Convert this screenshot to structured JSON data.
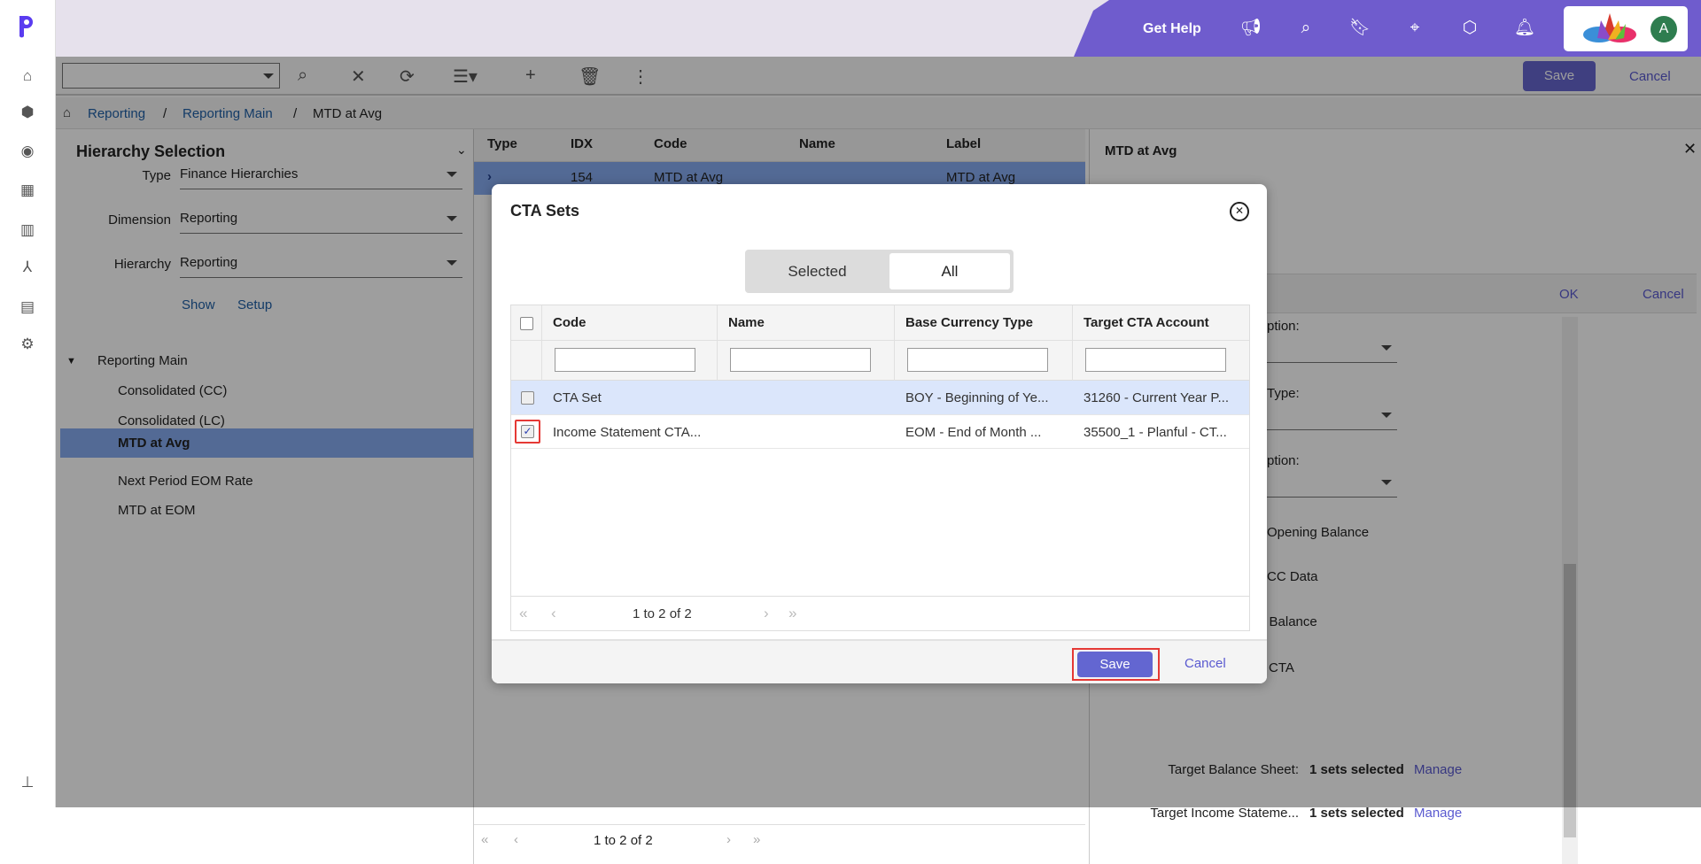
{
  "header": {
    "get_help": "Get Help",
    "avatar_initial": "A",
    "icons": [
      "megaphone-icon",
      "search-icon",
      "bookmark-icon",
      "crosshair-icon",
      "cube-icon",
      "bell-icon"
    ],
    "brand_color": "#6f5ccd"
  },
  "sidebar": {
    "icons": [
      "home-icon",
      "cube-icon",
      "target-icon",
      "grid-icon",
      "report-icon",
      "hierarchy-icon",
      "clipboard-icon",
      "gear-icon"
    ],
    "pin_icon": "pin-icon"
  },
  "toolbar": {
    "save": "Save",
    "cancel": "Cancel"
  },
  "breadcrumb": {
    "items": [
      "Reporting",
      "Reporting Main"
    ],
    "current": "MTD at Avg",
    "sep": "/"
  },
  "left_panel": {
    "title": "Hierarchy Selection",
    "fields": [
      {
        "label": "Type",
        "value": "Finance Hierarchies"
      },
      {
        "label": "Dimension",
        "value": "Reporting"
      },
      {
        "label": "Hierarchy",
        "value": "Reporting"
      }
    ],
    "show": "Show",
    "setup": "Setup",
    "tree": {
      "root": "Reporting Main",
      "items": [
        "Consolidated (CC)",
        "Consolidated (LC)",
        "MTD at Avg",
        "Next Period EOM Rate",
        "MTD at EOM"
      ],
      "selected": 2
    }
  },
  "grid": {
    "columns": [
      "Type",
      "IDX",
      "Code",
      "Name",
      "Label"
    ],
    "row": {
      "idx": "154",
      "code": "MTD at Avg",
      "name": "",
      "label": "MTD at Avg"
    },
    "pager": "1 to 2 of 2"
  },
  "right_panel": {
    "title": "MTD at Avg",
    "ok": "OK",
    "cancel": "Cancel",
    "fragments": [
      "ption:",
      "Type:",
      "ption:",
      "Opening Balance",
      "CC Data",
      "g Balance",
      "CTA"
    ],
    "rows": [
      {
        "label": "Target Balance Sheet:",
        "value": "1 sets selected",
        "action": "Manage"
      },
      {
        "label": "Target Income Stateme...",
        "value": "1 sets selected",
        "action": "Manage"
      }
    ]
  },
  "modal": {
    "title": "CTA Sets",
    "toggle": {
      "selected": "Selected",
      "all": "All",
      "active": "All"
    },
    "columns": [
      "Code",
      "Name",
      "Base Currency Type",
      "Target CTA Account"
    ],
    "rows": [
      {
        "code": "CTA Set",
        "name": "",
        "base": "BOY - Beginning of Ye...",
        "target": "31260 - Current Year P...",
        "checked": false
      },
      {
        "code": "Income Statement CTA...",
        "name": "",
        "base": "EOM - End of Month ...",
        "target": "35500_1 - Planful - CT...",
        "checked": true
      }
    ],
    "pager": "1 to 2 of 2",
    "save": "Save",
    "cancel": "Cancel"
  }
}
